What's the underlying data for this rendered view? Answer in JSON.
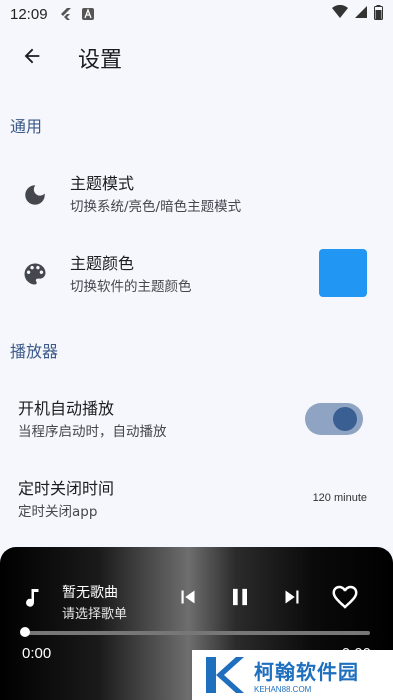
{
  "status": {
    "time": "12:09"
  },
  "header": {
    "title": "设置"
  },
  "sections": {
    "general": "通用",
    "player": "播放器"
  },
  "settings": {
    "theme_mode": {
      "title": "主题模式",
      "subtitle": "切换系统/亮色/暗色主题模式"
    },
    "theme_color": {
      "title": "主题颜色",
      "subtitle": "切换软件的主题颜色",
      "color": "#2196f3"
    },
    "autoplay": {
      "title": "开机自动播放",
      "subtitle": "当程序启动时，自动播放",
      "enabled": true
    },
    "sleep_timer": {
      "title": "定时关闭时间",
      "subtitle": "定时关闭app",
      "value": "120 minute"
    }
  },
  "player": {
    "song_title": "暂无歌曲",
    "song_subtitle": "请选择歌单",
    "current_time": "0:00",
    "total_time": "0:00",
    "progress": 0
  },
  "watermark": {
    "name": "柯翰软件园",
    "url": "KEHAN88.COM"
  },
  "colors": {
    "accent": "#3c5a89",
    "toggle_track": "#8ea4c2",
    "toggle_knob": "#3a5f92"
  }
}
